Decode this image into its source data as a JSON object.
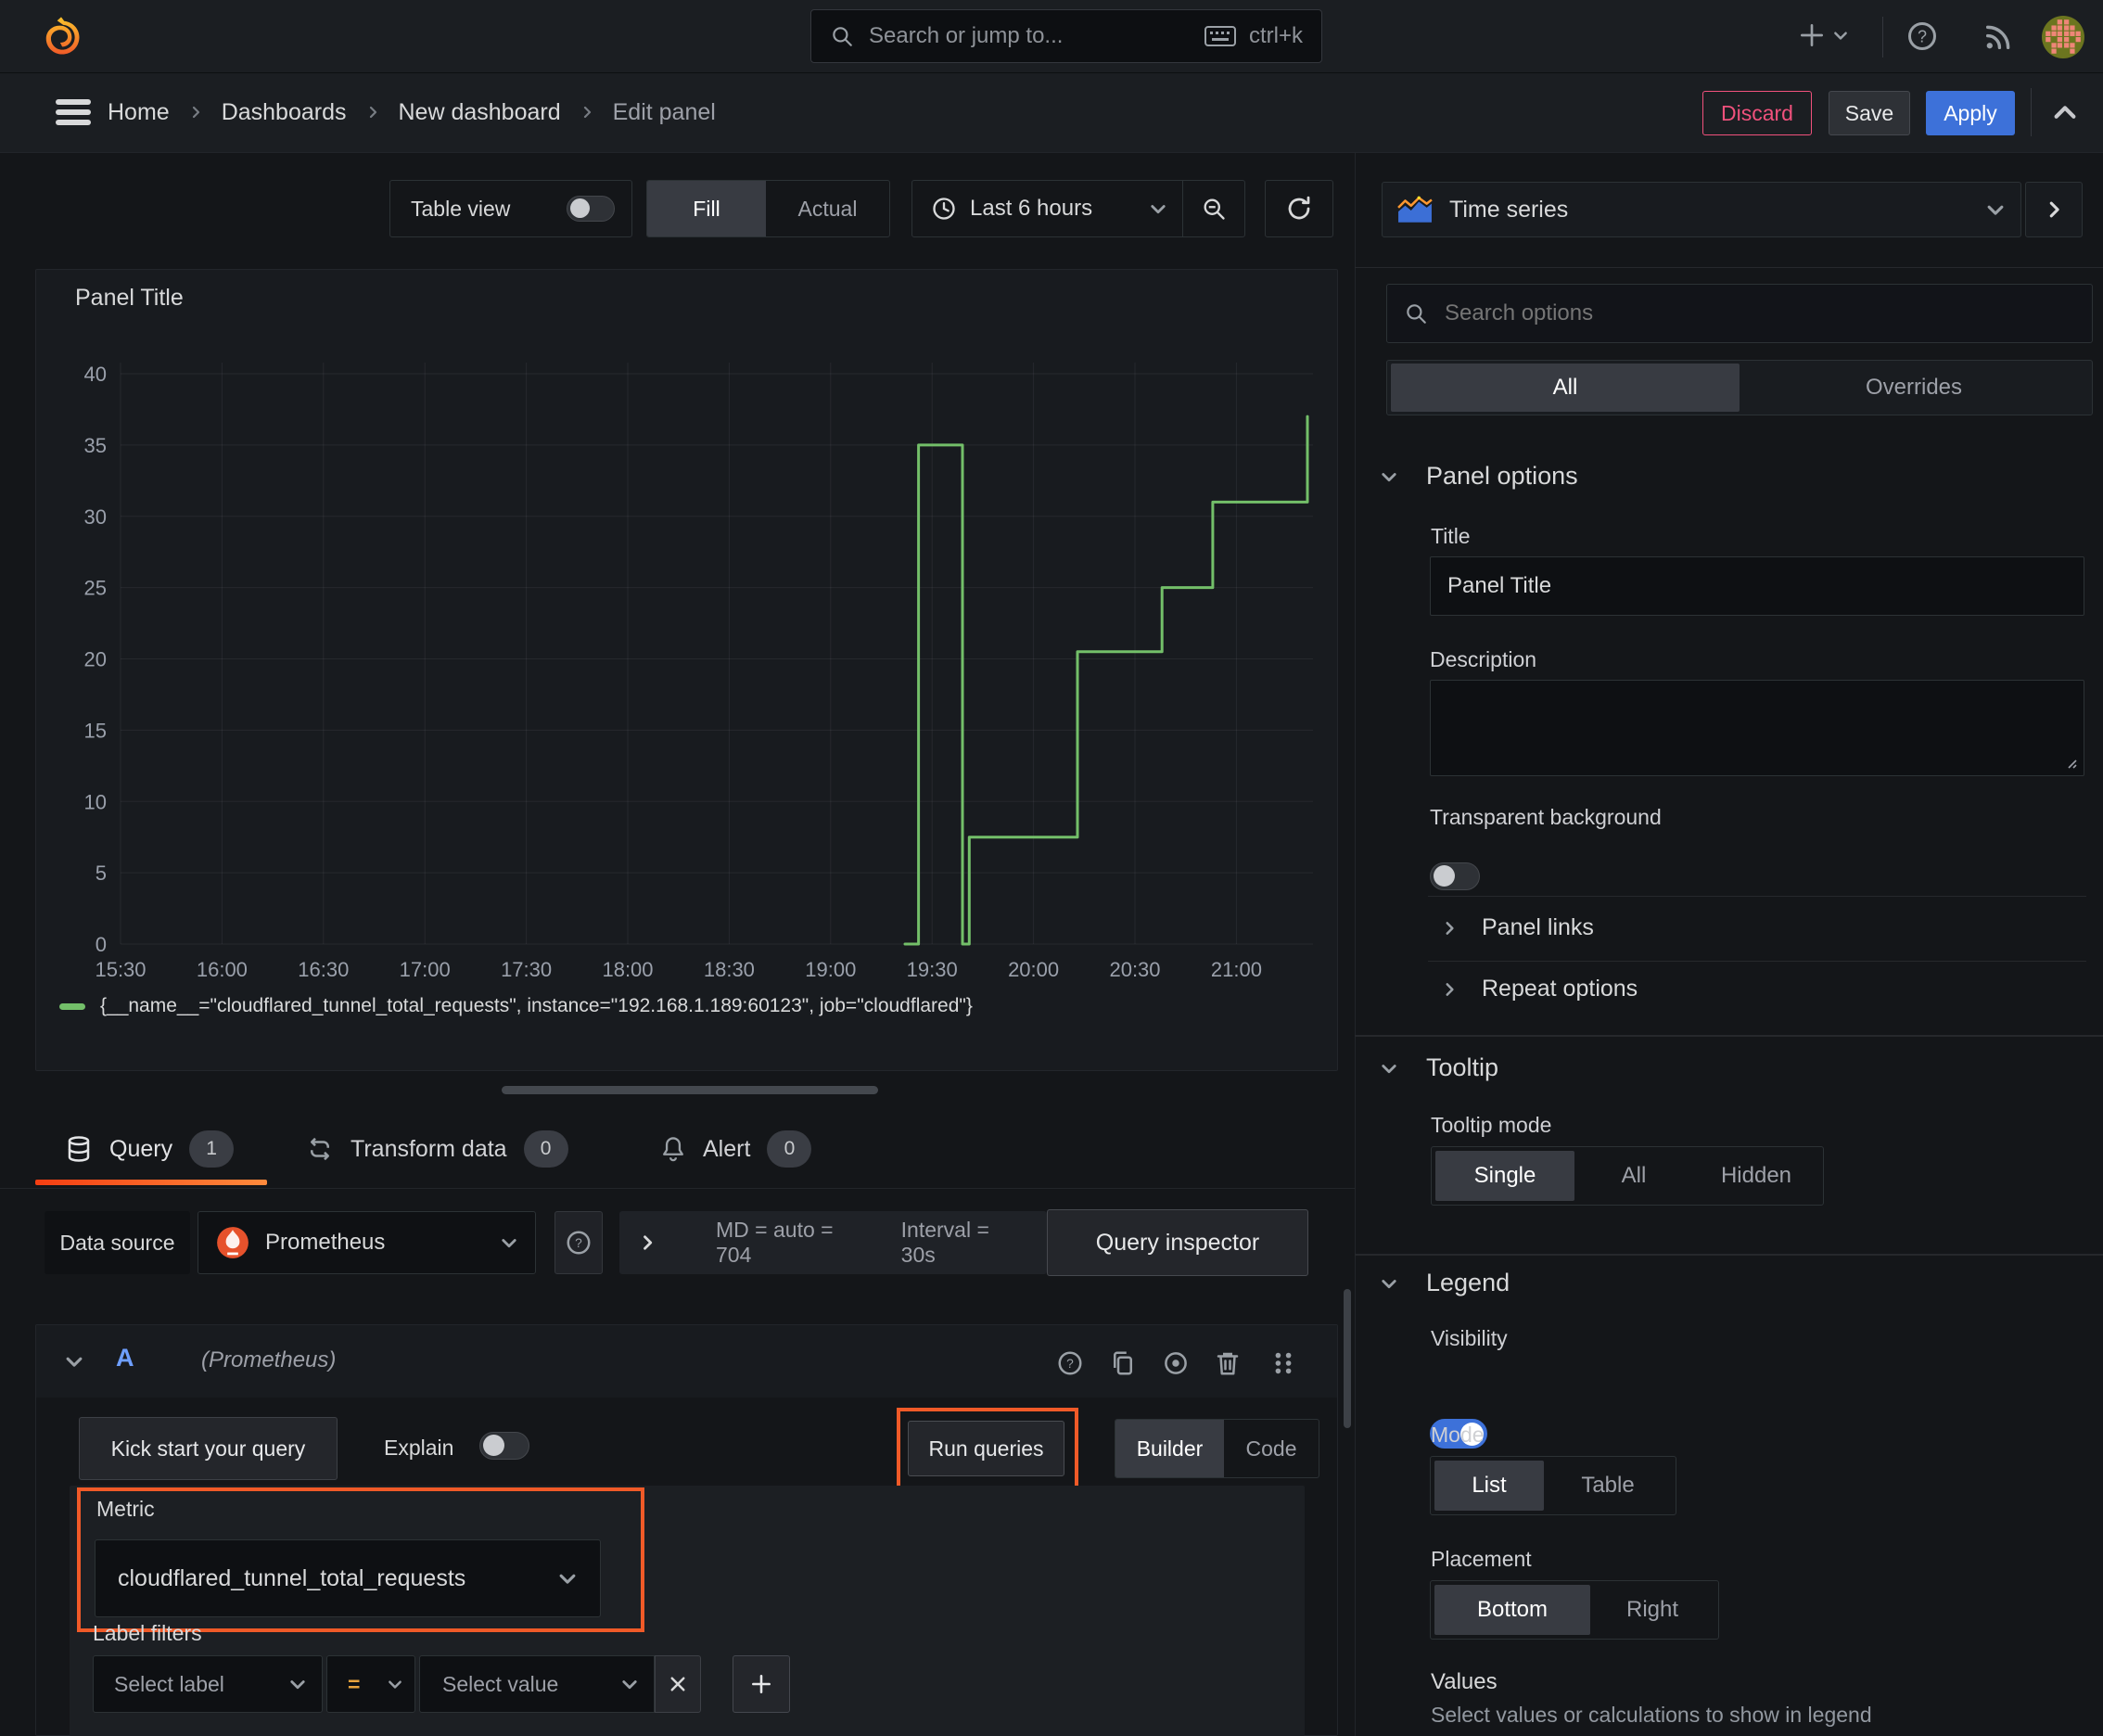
{
  "topnav": {
    "search_placeholder": "Search or jump to...",
    "shortcut": "ctrl+k"
  },
  "breadcrumb": {
    "items": [
      "Home",
      "Dashboards",
      "New dashboard",
      "Edit panel"
    ],
    "discard": "Discard",
    "save": "Save",
    "apply": "Apply"
  },
  "toolbar": {
    "table_view": "Table view",
    "fill": "Fill",
    "actual": "Actual",
    "time_range": "Last 6 hours"
  },
  "panel": {
    "title": "Panel Title",
    "legend_item": "{__name__=\"cloudflared_tunnel_total_requests\", instance=\"192.168.1.189:60123\", job=\"cloudflared\"}"
  },
  "chart_data": {
    "type": "line",
    "title": "Panel Title",
    "x_ticks": [
      "15:30",
      "16:00",
      "16:30",
      "17:00",
      "17:30",
      "18:00",
      "18:30",
      "19:00",
      "19:30",
      "20:00",
      "20:30",
      "21:00"
    ],
    "x_tick_minutes": [
      0,
      30,
      60,
      90,
      120,
      150,
      180,
      210,
      240,
      270,
      300,
      330
    ],
    "y_ticks": [
      0,
      5,
      10,
      15,
      20,
      25,
      30,
      35,
      40
    ],
    "ylim": [
      0,
      41
    ],
    "xlim_minutes": [
      -4,
      352
    ],
    "grid": true,
    "legend_position": "bottom",
    "series": [
      {
        "name": "{__name__=\"cloudflared_tunnel_total_requests\", instance=\"192.168.1.189:60123\", job=\"cloudflared\"}",
        "color": "#73bf69",
        "points_minutes_value": [
          [
            232,
            0
          ],
          [
            236,
            0
          ],
          [
            236,
            35
          ],
          [
            249,
            35
          ],
          [
            249,
            0
          ],
          [
            251,
            0
          ],
          [
            251,
            7.5
          ],
          [
            283,
            7.5
          ],
          [
            283,
            20.5
          ],
          [
            308,
            20.5
          ],
          [
            308,
            25
          ],
          [
            323,
            25
          ],
          [
            323,
            31
          ],
          [
            351,
            31
          ],
          [
            351,
            37
          ]
        ]
      }
    ]
  },
  "tabs": {
    "query": {
      "label": "Query",
      "count": "1"
    },
    "transform": {
      "label": "Transform data",
      "count": "0"
    },
    "alert": {
      "label": "Alert",
      "count": "0"
    }
  },
  "datasource": {
    "label": "Data source",
    "value": "Prometheus",
    "md_stat": "MD = auto = 704",
    "interval_stat": "Interval = 30s",
    "inspector": "Query inspector"
  },
  "query_editor": {
    "ref_id": "A",
    "ds_hint": "(Prometheus)",
    "kick_start": "Kick start your query",
    "explain": "Explain",
    "run_queries": "Run queries",
    "builder": "Builder",
    "code": "Code",
    "metric_label": "Metric",
    "metric_value": "cloudflared_tunnel_total_requests",
    "label_filters": "Label filters",
    "select_label": "Select label",
    "operator": "=",
    "select_value": "Select value"
  },
  "sidebar": {
    "viz_name": "Time series",
    "search_placeholder": "Search options",
    "tab_all": "All",
    "tab_overrides": "Overrides",
    "panel_options": {
      "header": "Panel options",
      "title_label": "Title",
      "title_value": "Panel Title",
      "description_label": "Description",
      "transparent_label": "Transparent background"
    },
    "panel_links": "Panel links",
    "repeat_options": "Repeat options",
    "tooltip": {
      "header": "Tooltip",
      "mode_label": "Tooltip mode",
      "options": [
        "Single",
        "All",
        "Hidden"
      ]
    },
    "legend": {
      "header": "Legend",
      "visibility_label": "Visibility",
      "mode_label": "Mode",
      "mode_options": [
        "List",
        "Table"
      ],
      "placement_label": "Placement",
      "placement_options": [
        "Bottom",
        "Right"
      ],
      "values_label": "Values",
      "values_hint": "Select values or calculations to show in legend"
    }
  },
  "colors": {
    "canvas": "#141619",
    "topnav": "#1b1e22",
    "panel": "#181b1f",
    "blue": "#3d71d9",
    "blue-text": "#6e9fff",
    "green": "#73bf69",
    "pink": "#f0517c",
    "annotation": "#f05a28",
    "orange2": "#ff8a3c",
    "prometheus": "#e6522c",
    "grid-line": "rgba(204,204,220,0.08)",
    "axis-text": "#9aa0ab",
    "text": "#d8d9da",
    "text-dim": "#9da0a8"
  }
}
